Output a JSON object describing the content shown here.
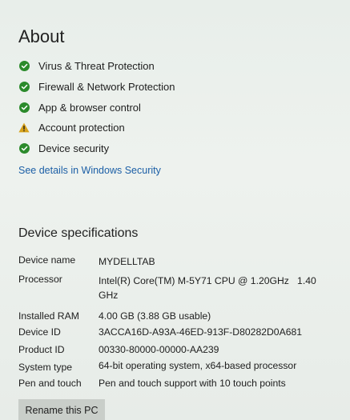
{
  "about": {
    "title": "About",
    "security_items": [
      {
        "label": "Virus & Threat Protection",
        "status": "ok",
        "icon": "check-circle-icon",
        "color": "#2b8a2b"
      },
      {
        "label": "Firewall & Network Protection",
        "status": "ok",
        "icon": "check-circle-icon",
        "color": "#2b8a2b"
      },
      {
        "label": "App & browser control",
        "status": "ok",
        "icon": "check-circle-icon",
        "color": "#2b8a2b"
      },
      {
        "label": "Account protection",
        "status": "warning",
        "icon": "warning-triangle-icon",
        "color": "#d7a21b"
      },
      {
        "label": "Device security",
        "status": "ok",
        "icon": "check-circle-icon",
        "color": "#2b8a2b"
      }
    ],
    "link_text": "See details in Windows Security"
  },
  "specs": {
    "title": "Device specifications",
    "rows": [
      {
        "key": "Device name",
        "value": "MYDELLTAB"
      },
      {
        "key": "Processor",
        "value": "Intel(R) Core(TM) M-5Y71 CPU @ 1.20GHz   1.40 GHz"
      },
      {
        "key": "Installed RAM",
        "value": "4.00 GB (3.88 GB usable)"
      },
      {
        "key": "Device ID",
        "value": "3ACCA16D-A93A-46ED-913F-D80282D0A681"
      },
      {
        "key": "Product ID",
        "value": "00330-80000-00000-AA239"
      },
      {
        "key": "System type",
        "value": "64-bit operating system, x64-based processor"
      },
      {
        "key": "Pen and touch",
        "value": "Pen and touch support with 10 touch points"
      }
    ]
  },
  "actions": {
    "rename_label": "Rename this PC"
  }
}
